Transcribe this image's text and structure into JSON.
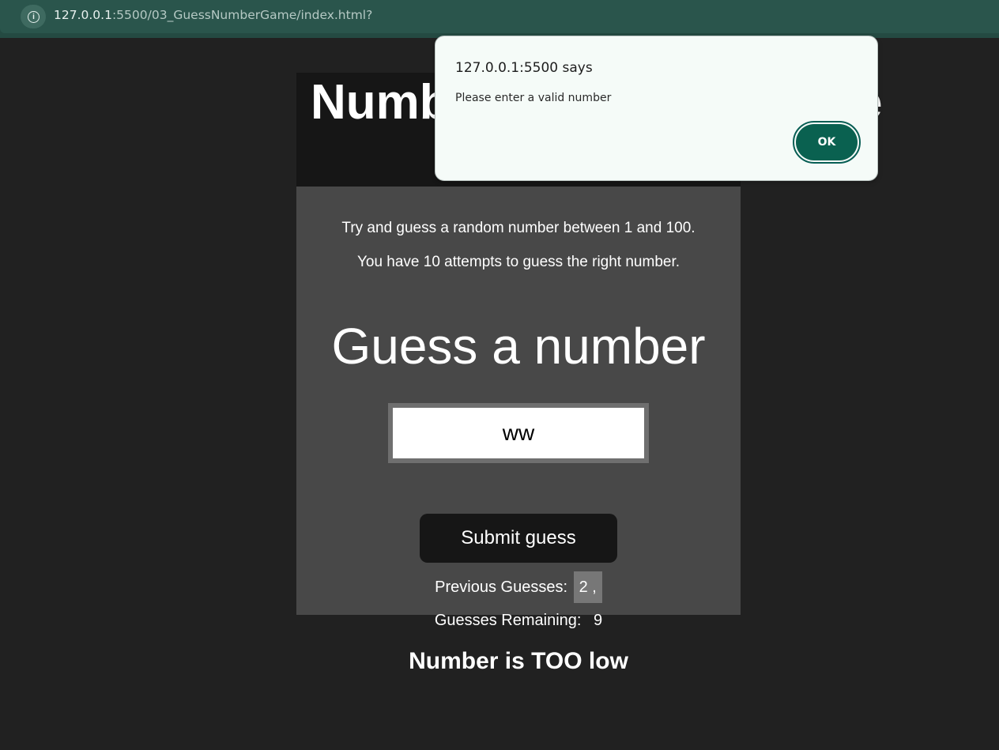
{
  "browser": {
    "url_host": "127.0.0.1",
    "url_rest": ":5500/03_GuessNumberGame/index.html?",
    "site_info_icon": "info-icon"
  },
  "game": {
    "title": "Number Guessing Game",
    "intro_line_1": "Try and guess a random number between 1 and 100.",
    "intro_line_2": "You have 10 attempts to guess the right number.",
    "guess_heading": "Guess a number",
    "guess_input_value": "ww",
    "submit_label": "Submit guess",
    "previous_label": "Previous Guesses:",
    "previous_values": "2 ,",
    "remaining_label": "Guesses Remaining:",
    "remaining_value": "9",
    "result_message": "Number is TOO low"
  },
  "dialog": {
    "title": "127.0.0.1:5500 says",
    "message": "Please enter a valid number",
    "ok_label": "OK"
  },
  "colors": {
    "page_background": "#212121",
    "card_header": "#161616",
    "card_body": "#484848",
    "dialog_accent": "#0a6150"
  }
}
